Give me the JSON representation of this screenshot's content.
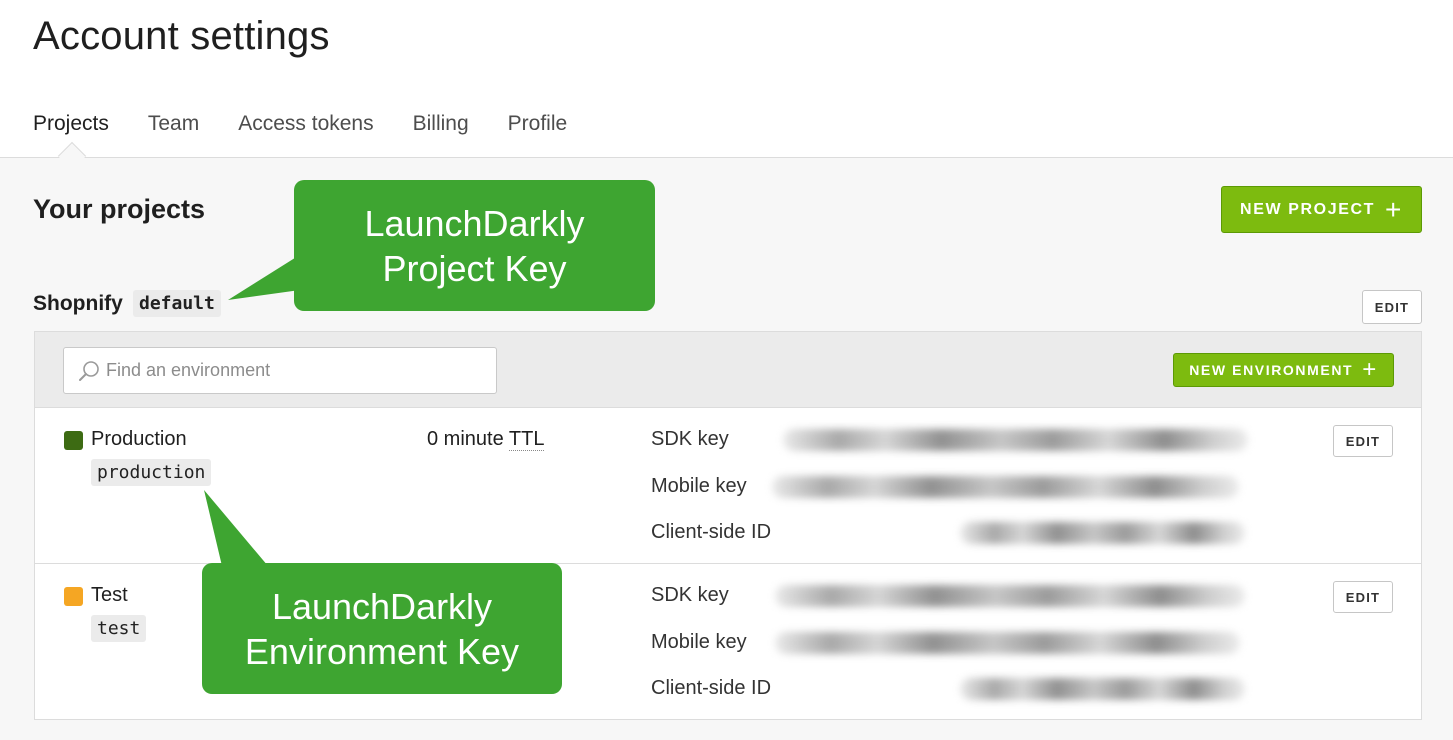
{
  "page": {
    "title": "Account settings"
  },
  "tabs": [
    {
      "label": "Projects",
      "active": true
    },
    {
      "label": "Team",
      "active": false
    },
    {
      "label": "Access tokens",
      "active": false
    },
    {
      "label": "Billing",
      "active": false
    },
    {
      "label": "Profile",
      "active": false
    }
  ],
  "projects_section": {
    "title": "Your projects",
    "new_project_label": "NEW PROJECT"
  },
  "project": {
    "name": "Shopnify",
    "key": "default",
    "edit_label": "EDIT"
  },
  "environments_toolbar": {
    "search_placeholder": "Find an environment",
    "new_environment_label": "NEW ENVIRONMENT"
  },
  "environments": [
    {
      "name": "Production",
      "key": "production",
      "color": "#3d6b13",
      "ttl_value": "0 minute",
      "ttl_unit": "TTL",
      "sdk_key_label": "SDK key",
      "mobile_key_label": "Mobile key",
      "client_id_label": "Client-side ID",
      "edit_label": "EDIT"
    },
    {
      "name": "Test",
      "key": "test",
      "color": "#f5a623",
      "sdk_key_label": "SDK key",
      "mobile_key_label": "Mobile key",
      "client_id_label": "Client-side ID",
      "edit_label": "EDIT"
    }
  ],
  "annotations": {
    "project_key": [
      "LaunchDarkly",
      "Project Key"
    ],
    "environment_key": [
      "LaunchDarkly",
      "Environment Key"
    ],
    "color": "#3ea531"
  },
  "colors": {
    "accent_green": "#7dbb0f",
    "page_bg": "#f7f7f7",
    "toolbar_bg": "#ebebeb"
  }
}
